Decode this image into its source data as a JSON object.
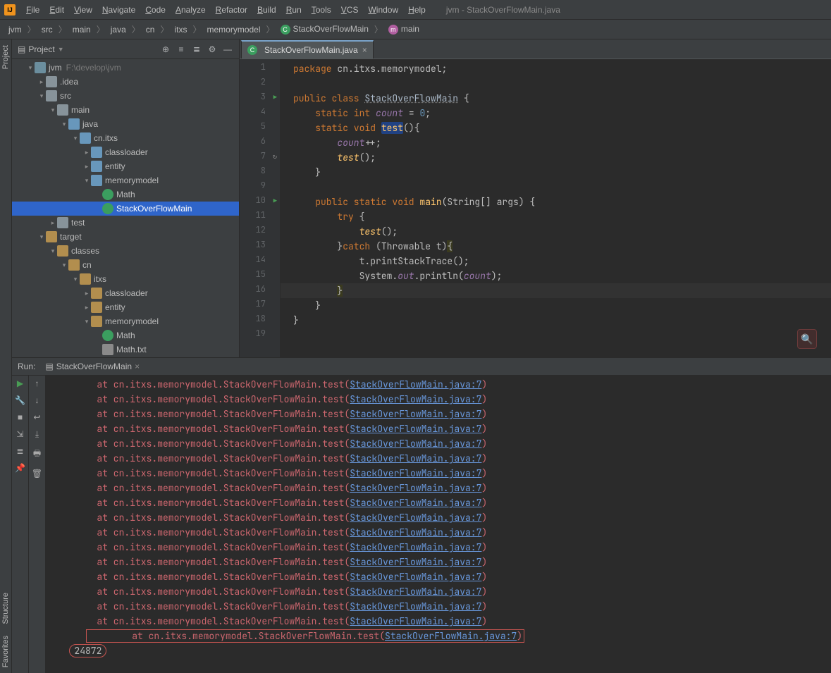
{
  "window_title": "jvm - StackOverFlowMain.java",
  "menu": [
    "File",
    "Edit",
    "View",
    "Navigate",
    "Code",
    "Analyze",
    "Refactor",
    "Build",
    "Run",
    "Tools",
    "VCS",
    "Window",
    "Help"
  ],
  "breadcrumb": {
    "items": [
      "jvm",
      "src",
      "main",
      "java",
      "cn",
      "itxs",
      "memorymodel"
    ],
    "class": "StackOverFlowMain",
    "method": "main"
  },
  "project_panel": {
    "title": "Project",
    "root": {
      "name": "jvm",
      "path": "F:\\develop\\jvm"
    },
    "tree": [
      {
        "depth": 0,
        "arrow": "▾",
        "icon": "ic-module",
        "label": "jvm",
        "suffix": "F:\\develop\\jvm"
      },
      {
        "depth": 1,
        "arrow": "▸",
        "icon": "ic-folder",
        "label": ".idea"
      },
      {
        "depth": 1,
        "arrow": "▾",
        "icon": "ic-folder",
        "label": "src"
      },
      {
        "depth": 2,
        "arrow": "▾",
        "icon": "ic-folder",
        "label": "main"
      },
      {
        "depth": 3,
        "arrow": "▾",
        "icon": "ic-pkg",
        "label": "java"
      },
      {
        "depth": 4,
        "arrow": "▾",
        "icon": "ic-pkg",
        "label": "cn.itxs"
      },
      {
        "depth": 5,
        "arrow": "▸",
        "icon": "ic-pkg",
        "label": "classloader"
      },
      {
        "depth": 5,
        "arrow": "▸",
        "icon": "ic-pkg",
        "label": "entity"
      },
      {
        "depth": 5,
        "arrow": "▾",
        "icon": "ic-pkg",
        "label": "memorymodel"
      },
      {
        "depth": 6,
        "arrow": " ",
        "icon": "ic-class",
        "label": "Math"
      },
      {
        "depth": 6,
        "arrow": " ",
        "icon": "ic-class",
        "label": "StackOverFlowMain",
        "selected": true
      },
      {
        "depth": 2,
        "arrow": "▸",
        "icon": "ic-folder",
        "label": "test"
      },
      {
        "depth": 1,
        "arrow": "▾",
        "icon": "ic-folder-o",
        "label": "target"
      },
      {
        "depth": 2,
        "arrow": "▾",
        "icon": "ic-folder-o",
        "label": "classes"
      },
      {
        "depth": 3,
        "arrow": "▾",
        "icon": "ic-folder-o",
        "label": "cn"
      },
      {
        "depth": 4,
        "arrow": "▾",
        "icon": "ic-folder-o",
        "label": "itxs"
      },
      {
        "depth": 5,
        "arrow": "▸",
        "icon": "ic-folder-o",
        "label": "classloader"
      },
      {
        "depth": 5,
        "arrow": "▸",
        "icon": "ic-folder-o",
        "label": "entity"
      },
      {
        "depth": 5,
        "arrow": "▾",
        "icon": "ic-folder-o",
        "label": "memorymodel"
      },
      {
        "depth": 6,
        "arrow": " ",
        "icon": "ic-class",
        "label": "Math"
      },
      {
        "depth": 6,
        "arrow": " ",
        "icon": "ic-file",
        "label": "Math.txt"
      }
    ]
  },
  "editor": {
    "tab_label": "StackOverFlowMain.java",
    "lines": [
      {
        "n": 1,
        "html": "<span class='kw'>package</span> cn.itxs.memorymodel;"
      },
      {
        "n": 2,
        "html": ""
      },
      {
        "n": 3,
        "html": "<span class='kw'>public class</span> <span class='cls'>StackOverFlowMain</span> {",
        "run": true
      },
      {
        "n": 4,
        "html": "    <span class='kw'>static int</span> <span class='field'>count</span> = <span class='num'>0</span>;"
      },
      {
        "n": 5,
        "html": "    <span class='kw'>static void</span> <span class='fn hlbox'>test</span>(){"
      },
      {
        "n": 6,
        "html": "        <span class='field'>count</span>++;"
      },
      {
        "n": 7,
        "html": "        <span class='fn' style='font-style:italic'>test</span>();",
        "rec": true
      },
      {
        "n": 8,
        "html": "    }"
      },
      {
        "n": 9,
        "html": ""
      },
      {
        "n": 10,
        "html": "    <span class='kw'>public static void</span> <span class='fn'>main</span>(String[] args) {",
        "run": true
      },
      {
        "n": 11,
        "html": "        <span class='kw'>try</span> {"
      },
      {
        "n": 12,
        "html": "            <span class='fn' style='font-style:italic'>test</span>();"
      },
      {
        "n": 13,
        "html": "        }<span class='kw'>catch</span> (Throwable t)<span style='background:#3a3a1f'>{</span>"
      },
      {
        "n": 14,
        "html": "            t.printStackTrace();"
      },
      {
        "n": 15,
        "html": "            System.<span class='field'>out</span>.println(<span class='field'>count</span>);"
      },
      {
        "n": 16,
        "html": "        <span style='background:#3a3a1f'>}</span>",
        "hl": true
      },
      {
        "n": 17,
        "html": "    }"
      },
      {
        "n": 18,
        "html": "}"
      },
      {
        "n": 19,
        "html": ""
      }
    ]
  },
  "run": {
    "label": "Run:",
    "config": "StackOverFlowMain",
    "stack_prefix": "        at cn.itxs.memorymodel.StackOverFlowMain.test(",
    "stack_link": "StackOverFlowMain.java:7",
    "stack_suffix": ")",
    "count_value": "24872",
    "stack_repeat": 18
  },
  "side_tabs": [
    "Project",
    "Structure",
    "Favorites"
  ]
}
